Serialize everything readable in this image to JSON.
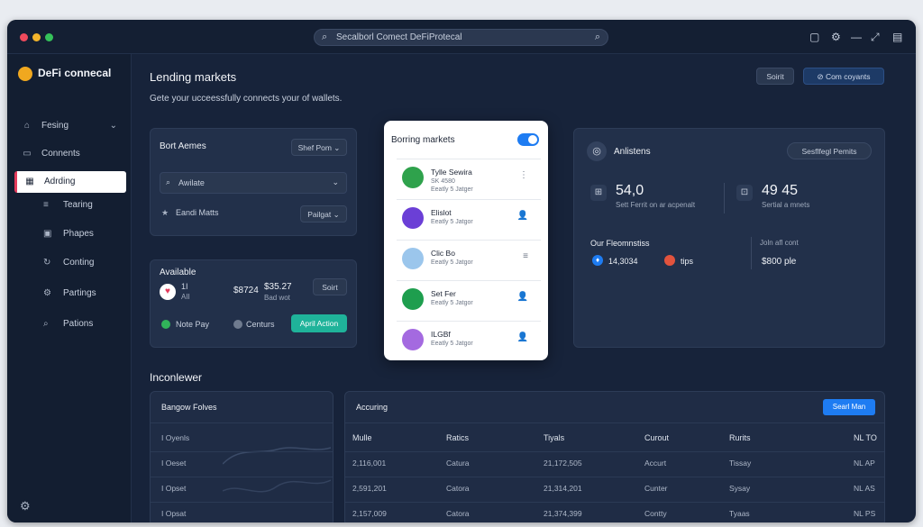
{
  "titlebar": {
    "search_text": "Secalborl Comect DeFiProtecal",
    "dot_colors": [
      "#ef4a5c",
      "#f3b42b",
      "#35c25a"
    ]
  },
  "sidebar": {
    "brand": "DeFi connecal",
    "items": [
      {
        "label": "Fesing",
        "icon": "dashboard-icon"
      },
      {
        "label": "Connents",
        "icon": "folder-icon"
      },
      {
        "label": "Adrding",
        "icon": "grid-icon"
      }
    ],
    "subitems": [
      {
        "label": "Tearing",
        "icon": "list-icon"
      },
      {
        "label": "Phapes",
        "icon": "image-icon"
      },
      {
        "label": "Conting",
        "icon": "refresh-icon"
      },
      {
        "label": "Partings",
        "icon": "settings-icon"
      },
      {
        "label": "Pations",
        "icon": "search-icon"
      }
    ]
  },
  "header": {
    "title": "Lending markets",
    "subtitle": "Gete your ucceessfully connects your of wallets.",
    "btn_sort": "Soirit",
    "btn_connect": "Com coyants"
  },
  "bort_card": {
    "title": "Bort Aemes",
    "dropdown": "Shef Pom",
    "search_placeholder": "Awilate",
    "star_label": "Eandi Matts",
    "select_label": "Pailgat"
  },
  "available_card": {
    "title": "Available",
    "asset_a": "1I",
    "asset_b": "AII",
    "amount": "$8724",
    "total": "$35.27",
    "total_sub": "Bad wot",
    "btn_sort": "Soirt",
    "note": "Note Pay",
    "centure": "Centurs",
    "action_btn": "April Action"
  },
  "borring": {
    "title": "Borring markets",
    "rows": [
      {
        "name": "Tylle Sewira",
        "line1": "SK 4580",
        "line2": "Eeatly 5 Jatger",
        "avatar_color": "#2fa24c",
        "icon": "more-icon",
        "glyph": "⋮"
      },
      {
        "name": "Elislot",
        "line1": "",
        "line2": "Eeatly 5 Jatgor",
        "avatar_color": "#6b3fd6",
        "icon": "user-icon",
        "glyph": "👤"
      },
      {
        "name": "Clic Bo",
        "line1": "",
        "line2": "Eeatly 5 Jatgor",
        "avatar_color": "#9bc6ec",
        "icon": "menu-icon",
        "glyph": "≡"
      },
      {
        "name": "Set Fer",
        "line1": "",
        "line2": "Eeatly 5 Jatgor",
        "avatar_color": "#1e9e4e",
        "icon": "user-icon",
        "glyph": "👤"
      },
      {
        "name": "ILGBf",
        "line1": "",
        "line2": "Eeatly 5 Jatgor",
        "avatar_color": "#a46ae0",
        "icon": "user-icon",
        "glyph": "👤"
      }
    ]
  },
  "analytics": {
    "title": "Anlistens",
    "btn": "Sesflfegl Pemits",
    "metric1_value": "54,0",
    "metric1_label": "Sett Ferrit on ar acpenalt",
    "metric2_value": "49 45",
    "metric2_label": "Sertial a mnets",
    "section": "Our Fleomnstiss",
    "section_right": "Joln afl cont",
    "stat_a": "14,3034",
    "stat_b": "tips",
    "stat_c": "$800 ple"
  },
  "bottom": {
    "title": "Inconlewer",
    "left_card_title": "Bangow Folves",
    "left_rows": [
      "I Oyenls",
      "I Oeset",
      "I Opset",
      "I Opsat"
    ],
    "right_card_title": "Accuring",
    "right_btn": "Searl Man",
    "columns": [
      "Mulle",
      "Ratics",
      "Tiyals",
      "Curout",
      "Rurits",
      "NL TO"
    ],
    "rows": [
      [
        "2,116,001",
        "Catura",
        "21,172,505",
        "Accurt",
        "Tissay",
        "NL AP"
      ],
      [
        "2,591,201",
        "Catora",
        "21,314,201",
        "Cunter",
        "Sysay",
        "NL AS"
      ],
      [
        "2,157,009",
        "Catora",
        "21,374,399",
        "Contty",
        "Tyaas",
        "NL PS"
      ]
    ]
  },
  "colors": {
    "accent": "#1e7cf2",
    "teal": "#1fb39a"
  }
}
